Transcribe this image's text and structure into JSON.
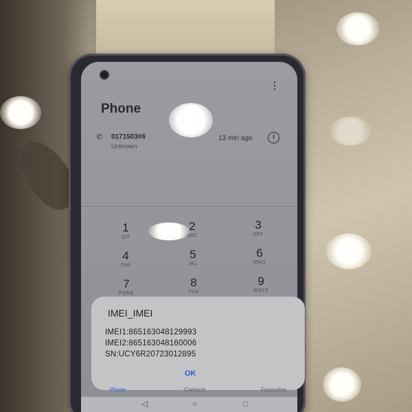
{
  "phone_app": {
    "title": "Phone",
    "recent_call": {
      "number": "0171503#6",
      "label": "Unknown",
      "time": "13 min ago"
    },
    "keypad": [
      {
        "digit": "1",
        "letters": "QO"
      },
      {
        "digit": "2",
        "letters": "ABC"
      },
      {
        "digit": "3",
        "letters": "DEF"
      },
      {
        "digit": "4",
        "letters": "GHI"
      },
      {
        "digit": "5",
        "letters": "JKL"
      },
      {
        "digit": "6",
        "letters": "MNO"
      },
      {
        "digit": "7",
        "letters": "PQRS"
      },
      {
        "digit": "8",
        "letters": "TUV"
      },
      {
        "digit": "9",
        "letters": "WXYZ"
      }
    ],
    "bottom_tabs": {
      "phone": "Phone",
      "contacts": "Contacts",
      "favourites": "Favourites"
    }
  },
  "dialog": {
    "title": "IMEI_IMEI",
    "imei1": "IMEI1:865163048129993",
    "imei2": "IMEI2:865163048160006",
    "sn": "SN:UCY6R20723012895",
    "ok_label": "OK"
  },
  "icons": {
    "call": "call-outgoing-icon",
    "info": "info-icon",
    "more": "more-vertical-icon"
  },
  "colors": {
    "accent": "#2a5fcf",
    "dialog_bg": "#c3c4c6"
  }
}
